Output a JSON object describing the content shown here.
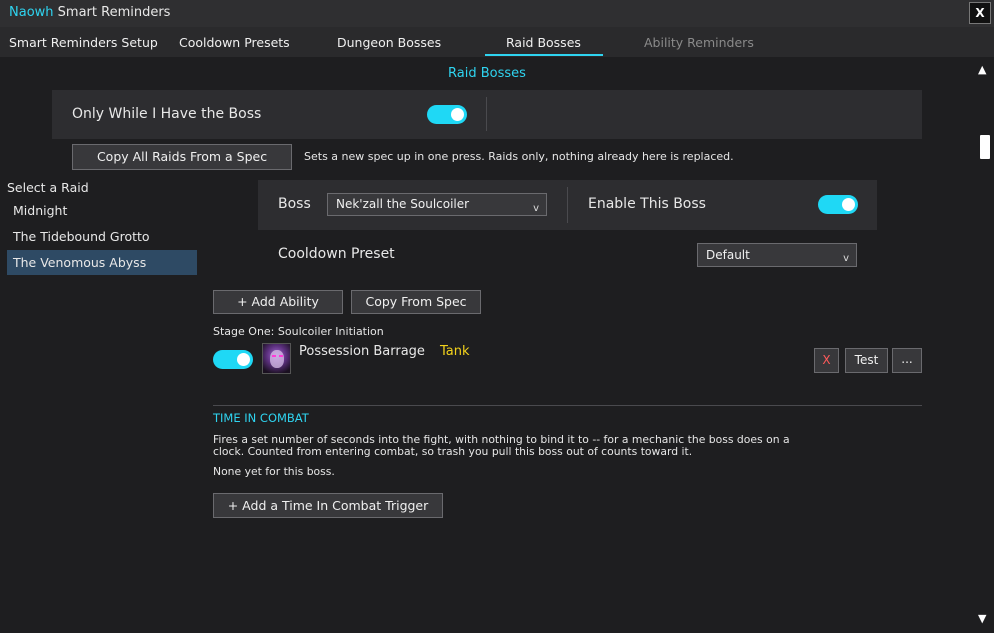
{
  "window": {
    "title_brand": "Naowh",
    "title_rest": " Smart Reminders",
    "close_label": "X"
  },
  "tabs": [
    {
      "label": "Smart Reminders Setup",
      "active": false
    },
    {
      "label": "Cooldown Presets",
      "active": false
    },
    {
      "label": "Dungeon Bosses",
      "active": false
    },
    {
      "label": "Raid Bosses",
      "active": true
    },
    {
      "label": "Ability Reminders",
      "disabled": true
    }
  ],
  "section_title": "Raid Bosses",
  "only_while": {
    "label": "Only While I Have the Boss",
    "enabled": true
  },
  "copy_raids": {
    "button_label": "Copy All Raids From a Spec",
    "description": "Sets a new spec up in one press. Raids only, nothing already here is replaced."
  },
  "sidebar": {
    "heading": "Select a Raid",
    "items": [
      {
        "label": "Midnight",
        "active": false
      },
      {
        "label": "The Tidebound Grotto",
        "active": false
      },
      {
        "label": "The Venomous Abyss",
        "active": true
      }
    ]
  },
  "boss": {
    "label": "Boss",
    "selected": "Nek'zall the Soulcoiler",
    "enable_label": "Enable This Boss",
    "enabled": true
  },
  "cooldown_preset": {
    "label": "Cooldown Preset",
    "selected": "Default"
  },
  "actions": {
    "add_ability": "+ Add Ability",
    "copy_from_spec": "Copy From Spec"
  },
  "stage": {
    "title": "Stage One: Soulcoiler Initiation",
    "abilities": [
      {
        "name": "Possession Barrage",
        "role": "Tank",
        "role_color": "#f2d21c",
        "enabled": true,
        "icon": "possession-barrage-icon",
        "remove_label": "X",
        "test_label": "Test",
        "more_label": "..."
      }
    ]
  },
  "time_in_combat": {
    "heading": "TIME IN COMBAT",
    "description_line1": "Fires a set number of seconds into the fight, with nothing to bind it to -- for a mechanic the boss does on a",
    "description_line2": "clock. Counted from entering combat, so trash you pull this boss out of counts toward it.",
    "empty_text": "None yet for this boss.",
    "add_button": "+ Add a Time In Combat Trigger"
  },
  "colors": {
    "accent": "#2fd4f0",
    "toggle_on": "#1fd8f5",
    "sidebar_active": "#2e4a64",
    "remove_x": "#ff5a5a"
  }
}
